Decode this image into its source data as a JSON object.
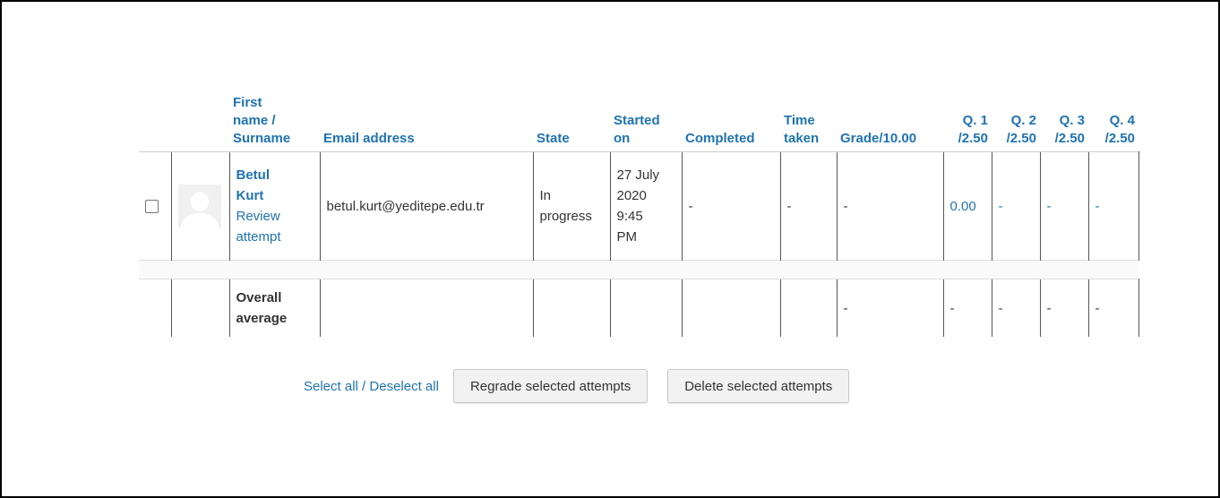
{
  "headers": {
    "name_line1": "First",
    "name_line2": "name /",
    "name_line3": "Surname",
    "email": "Email address",
    "state": "State",
    "started_line1": "Started",
    "started_line2": "on",
    "completed": "Completed",
    "time_line1": "Time",
    "time_line2": "taken",
    "grade": "Grade/10.00",
    "q1_line1": "Q. 1",
    "q1_line2": "/2.50",
    "q2_line1": "Q. 2",
    "q2_line2": "/2.50",
    "q3_line1": "Q. 3",
    "q3_line2": "/2.50",
    "q4_line1": "Q. 4",
    "q4_line2": "/2.50"
  },
  "attempt": {
    "first_name": "Betul",
    "surname": "Kurt",
    "review_line1": "Review",
    "review_line2": "attempt",
    "email": "betul.kurt@yeditepe.edu.tr",
    "state_line1": "In",
    "state_line2": "progress",
    "started_line1": "27 July",
    "started_line2": "2020",
    "started_line3": "9:45",
    "started_line4": "PM",
    "completed": "-",
    "time_taken": "-",
    "grade": "-",
    "q1": "0.00",
    "q2": "-",
    "q3": "-",
    "q4": "-"
  },
  "average": {
    "label_line1": "Overall",
    "label_line2": "average",
    "grade": "-",
    "q1": "-",
    "q2": "-",
    "q3": "-",
    "q4": "-"
  },
  "actions": {
    "select_all": "Select all",
    "separator": " / ",
    "deselect_all": "Deselect all",
    "regrade": "Regrade selected attempts",
    "delete": "Delete selected attempts"
  },
  "colors": {
    "link": "#1f73b1"
  }
}
